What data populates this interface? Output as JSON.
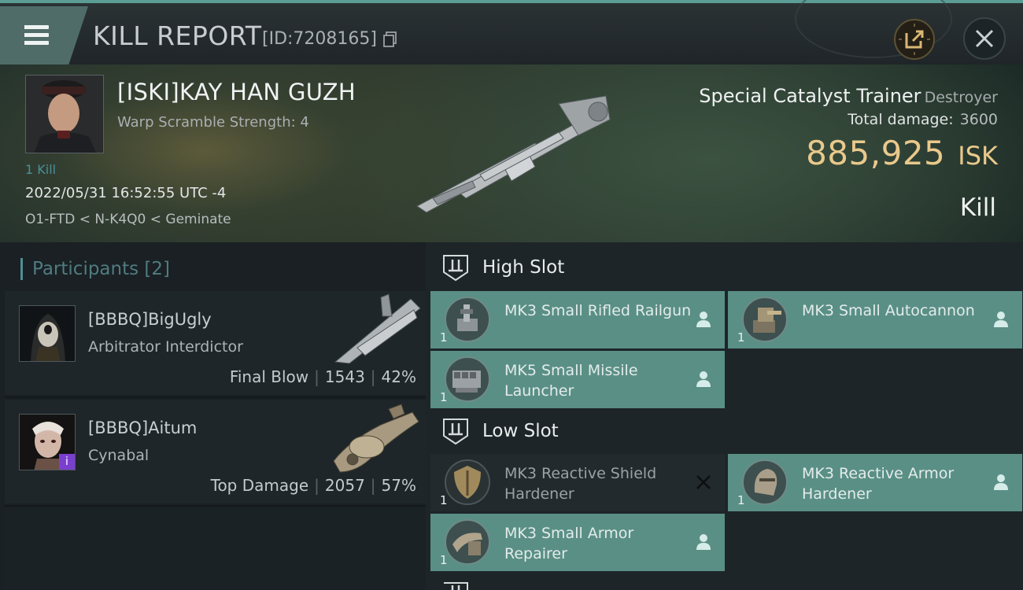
{
  "header": {
    "title": "KILL REPORT",
    "report_id": "[ID:7208165]"
  },
  "victim": {
    "name": "[ISKI]KAY HAN GUZH",
    "warp_scramble": "Warp Scramble Strength: 4",
    "kills": "1 Kill",
    "timestamp": "2022/05/31 16:52:55 UTC -4",
    "location": "O1-FTD < N-K4Q0 < Geminate"
  },
  "ship": {
    "name": "Special Catalyst Trainer",
    "class": "Destroyer",
    "damage_label": "Total damage:",
    "damage_value": "3600",
    "isk_value": "885,925",
    "isk_unit": "ISK",
    "result": "Kill"
  },
  "participants": {
    "label": "Participants",
    "count": "[2]",
    "items": [
      {
        "name": "[BBBQ]BigUgly",
        "ship": "Arbitrator Interdictor",
        "role": "Final Blow",
        "damage": "1543",
        "percent": "42%",
        "percent_value": 0.42
      },
      {
        "name": "[BBBQ]Aitum",
        "ship": "Cynabal",
        "role": "Top Damage",
        "damage": "2057",
        "percent": "57%",
        "percent_value": 0.57,
        "badge": "i"
      }
    ]
  },
  "fitting": {
    "high_slot": {
      "title": "High Slot",
      "modules": [
        {
          "name": "MK3 Small Rifled Railgun",
          "qty": "1",
          "status": "person-icon"
        },
        {
          "name": "MK3 Small Autocannon",
          "qty": "1",
          "status": "person-icon"
        },
        {
          "name": "MK5 Small Missile Launcher",
          "qty": "1",
          "status": "person-icon"
        }
      ]
    },
    "low_slot": {
      "title": "Low Slot",
      "modules": [
        {
          "name": "MK3 Reactive Shield Hardener",
          "qty": "1",
          "status": "destroyed-x-icon"
        },
        {
          "name": "MK3 Reactive Armor Hardener",
          "qty": "1",
          "status": "person-icon"
        },
        {
          "name": "MK3 Small Armor Repairer",
          "qty": "1",
          "status": "person-icon"
        }
      ]
    }
  },
  "colors": {
    "accent_teal": "#5a8f86",
    "isk_gold": "#e9c98b",
    "badge_purple": "#7b3fd0"
  }
}
